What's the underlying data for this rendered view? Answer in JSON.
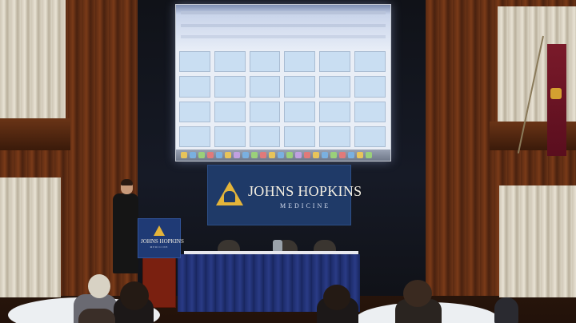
{
  "banner": {
    "title": "JOHNS HOPKINS",
    "subtitle": "MEDICINE"
  },
  "podium_sign": {
    "title": "JOHNS HOPKINS",
    "subtitle": "MEDICINE"
  },
  "colors": {
    "banner_blue": "#1f3a68",
    "shield_gold": "#e4b43a",
    "wood": "#6b3316",
    "table_skirt": "#1d2c6a"
  },
  "scene": {
    "projected_screen": "spreadsheet-window",
    "screen_grid": {
      "rows": 4,
      "columns": 6
    }
  }
}
